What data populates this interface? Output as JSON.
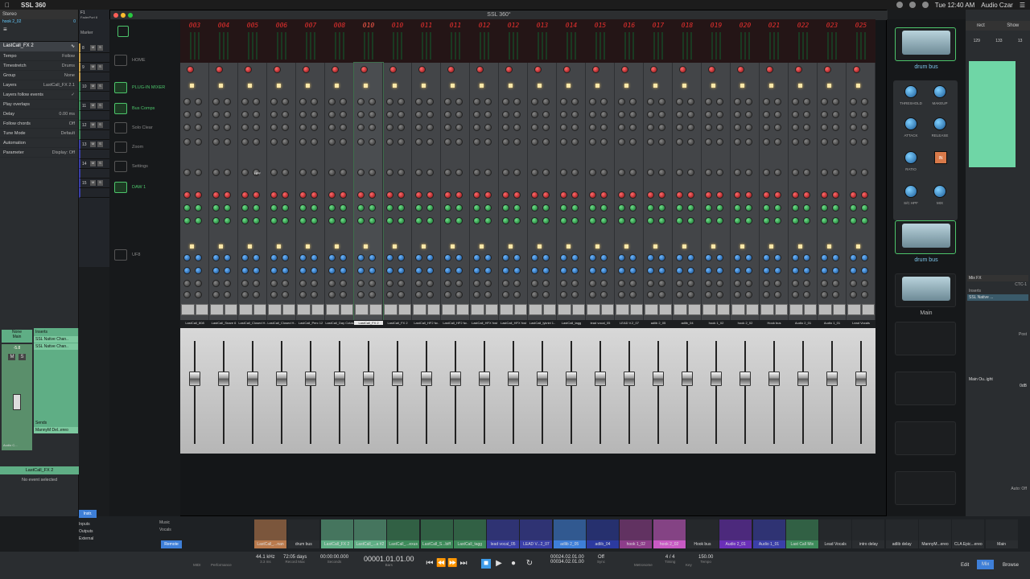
{
  "menubar": {
    "app_name": "SSL 360",
    "clock": "Tue 12:40 AM",
    "user": "Audio Czar"
  },
  "left_panel": {
    "track_label": "Stereo",
    "track_sub": "hook 2_02",
    "track_value": "0",
    "device": "F1",
    "device_sub": "FaderPort 8",
    "selected_channel": "LastCall_FX 2",
    "marker": "Marker",
    "rows": [
      {
        "k": "Tempo",
        "v": "Follow"
      },
      {
        "k": "Timestretch",
        "v": "Drums"
      },
      {
        "k": "Group",
        "v": "None"
      },
      {
        "k": "Layers",
        "v": "LastCall_FX 2.1"
      },
      {
        "k": "Layers follow events",
        "v": "✓"
      },
      {
        "k": "Play overlaps",
        "v": ""
      },
      {
        "k": "Delay",
        "v": "0.00 ms"
      },
      {
        "k": "Follow chords",
        "v": "Off"
      },
      {
        "k": "Tune Mode",
        "v": "Default"
      },
      {
        "k": "Automation",
        "v": ""
      },
      {
        "k": "Parameter",
        "v": "Display: Off"
      }
    ],
    "strip": {
      "none": "None",
      "main": "Main",
      "inserts": "Inserts",
      "insert1": "SSL Native Chan..",
      "insert2": "SSL Native Chan..",
      "sends": "Sends",
      "send1": "MannyM Del..ereo",
      "name": "LastCall_FX 2",
      "no_event": "No event selected",
      "pan": "Audio C...",
      "gain": "-5.8",
      "db": "-22"
    }
  },
  "track_list": [
    {
      "num": "8"
    },
    {
      "num": "9"
    },
    {
      "num": "10"
    },
    {
      "num": "11"
    },
    {
      "num": "12"
    },
    {
      "num": "13"
    },
    {
      "num": "14"
    },
    {
      "num": "15"
    }
  ],
  "window": {
    "title": "SSL 360°"
  },
  "ssl_nav": [
    {
      "label": "HOME",
      "active": false
    },
    {
      "label": "PLUG-IN MIXER",
      "active": true
    },
    {
      "label": "Bus Comps",
      "active": true
    },
    {
      "label": "Solo Clear",
      "active": false
    },
    {
      "label": "Zoom",
      "active": false
    },
    {
      "label": "Settings",
      "active": false
    },
    {
      "label": "DAW 1",
      "active": true
    },
    {
      "label": "UF8",
      "active": false
    }
  ],
  "mixer": {
    "channel_numbers": [
      "003",
      "004",
      "005",
      "006",
      "007",
      "008",
      "010",
      "010",
      "011",
      "011",
      "012",
      "012",
      "013",
      "014",
      "015",
      "016",
      "017",
      "018",
      "019",
      "020",
      "021",
      "022",
      "023",
      "025"
    ],
    "selected_index": 6,
    "channel_names": [
      "LastCall_808",
      "LastCall_Snare 6",
      "LastCall_Closed H..",
      "LastCall_Closed H..",
      "LastCall_Perc 12",
      "LastCall_Day Cotas",
      "LastCall_FX 2",
      "LastCall_FX 2",
      "LastCall_HF2 fw..",
      "LastCall_HF2 fw..",
      "LastCall_HFX fxst",
      "LastCall_HFX fxst",
      "LastCall_lyknbl 1..",
      "LastCall_tagg",
      "lead vocal_05",
      "LEAD V.2_07",
      "adlib 2_05",
      "adlib_04",
      "hook 1_02",
      "hook 2_02",
      "Hook bus",
      "Audio 2_01",
      "Audio 1_01",
      "Lead Vocals"
    ],
    "hpf_label": "HPF",
    "solo_label": "SOLO",
    "cut_label": "CUT"
  },
  "right_column": {
    "top_label": "drum bus",
    "bus_comp_knobs": [
      "THRESHOLD",
      "MAKEUP",
      "ATTACK",
      "RELEASE",
      "RATIO",
      "IN",
      "S/C HPF",
      "MIX"
    ],
    "bus_comp_button": "IN",
    "slots": [
      {
        "label": "drum bus",
        "active": true
      },
      {
        "label": "Main",
        "active": false
      },
      {
        "label": "",
        "active": false
      },
      {
        "label": "",
        "active": false
      },
      {
        "label": "",
        "active": false
      },
      {
        "label": "",
        "active": false
      }
    ]
  },
  "far_right": {
    "tabs": [
      "rect",
      "Show"
    ],
    "nums": [
      "129",
      "133",
      "13"
    ],
    "mix_fx": "Mix FX",
    "ctc": "CTC-1",
    "inserts": "Inserts",
    "insert1": "SSL Native ...",
    "post": "Post",
    "out": "Main Ou..ight",
    "db": "0dB",
    "auto": "Auto: Off"
  },
  "bottom_channels": [
    {
      "label": "LastCall_...nan",
      "color": "#b97a4d"
    },
    {
      "label": "drum bus",
      "color": "#2a2d30"
    },
    {
      "label": "LastCall_FX 2",
      "color": "#5fae85"
    },
    {
      "label": "LastCall_...a #2",
      "color": "#5fae85"
    },
    {
      "label": "LastCall_...exus",
      "color": "#3d8b5a"
    },
    {
      "label": "LastCall_S...biff",
      "color": "#3d8b5a"
    },
    {
      "label": "LastCall_tagg",
      "color": "#3d8b5a"
    },
    {
      "label": "lead vocal_05",
      "color": "#3a3fa8"
    },
    {
      "label": "LEAD V...2_07",
      "color": "#3a3fa8"
    },
    {
      "label": "adlib 2_05",
      "color": "#3e7fd8"
    },
    {
      "label": "adlib_04",
      "color": "#2c3aa0"
    },
    {
      "label": "hook 1_02",
      "color": "#8d3d8a"
    },
    {
      "label": "hook 2_02",
      "color": "#c85ac4"
    },
    {
      "label": "Hook bus",
      "color": "#2a2d30"
    },
    {
      "label": "Audio 2_01",
      "color": "#6a2fb8"
    },
    {
      "label": "Audio 1_01",
      "color": "#3a3fa8"
    },
    {
      "label": "Last Call Mix",
      "color": "#3d8b5a"
    },
    {
      "label": "Lead Vocals",
      "color": "#2a2d30"
    },
    {
      "label": "intro delay",
      "color": "#2a2d30"
    },
    {
      "label": "adlib delay",
      "color": "#2a2d30"
    },
    {
      "label": "MannyM...ereo",
      "color": "#2a2d30"
    },
    {
      "label": "CLA Epic...ereo",
      "color": "#2a2d30"
    },
    {
      "label": "Main",
      "color": "#2a2d30"
    }
  ],
  "bottom_left": {
    "inputs": "Inputs",
    "outputs": "Outputs",
    "external": "External",
    "instr": "Instr.",
    "remote": "Remote",
    "music": "Music",
    "vocals": "Vocals"
  },
  "transport": {
    "midi": "MIDI",
    "performance": "Performance",
    "sample_rate": "44.1 kHz",
    "latency": "3.3 ms",
    "record_max_value": "72:05 days",
    "record_max": "Record Max",
    "seconds_value": "00:00:00.000",
    "seconds": "Seconds",
    "bars_value": "00001.01.01.00",
    "bars": "Bars",
    "loop_start": "00024.02.01.00",
    "loop_end": "00034.02.01.00",
    "sync": "Off",
    "sync_label": "Sync",
    "metronome": "Metronome",
    "timesig": "4 / 4",
    "timing": "Timing",
    "key_label": "Key",
    "tempo_value": "150.00",
    "tempo": "Tempo",
    "edit": "Edit",
    "mix": "Mix",
    "browse": "Browse"
  }
}
